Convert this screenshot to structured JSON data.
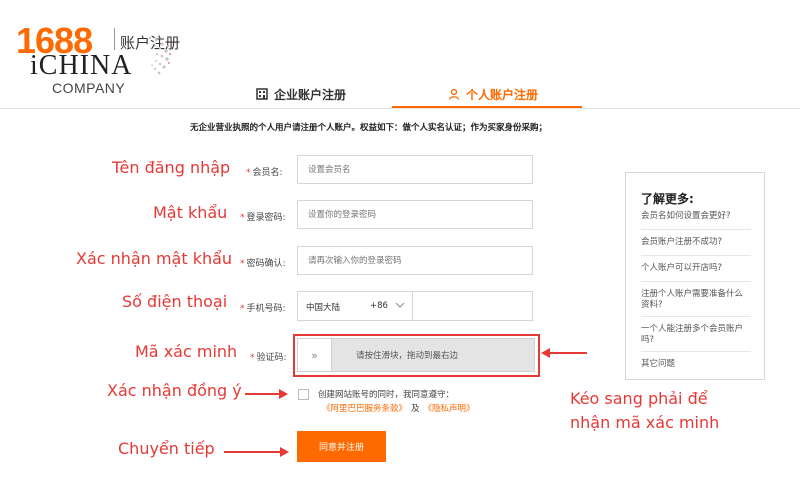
{
  "logo": {
    "brand": "1688",
    "sub": "账户注册",
    "watermark_line1": "iCHINA",
    "watermark_line2": "COMPANY"
  },
  "tabs": [
    {
      "label": "企业账户注册",
      "icon": "building-icon",
      "active": false
    },
    {
      "label": "个人账户注册",
      "icon": "user-icon",
      "active": true
    }
  ],
  "notice": "无企业营业执照的个人用户请注册个人账户。权益如下：做个人实名认证；作为买家身份采购；",
  "form": {
    "username": {
      "label": "会员名:",
      "placeholder": "设置会员名"
    },
    "password": {
      "label": "登录密码:",
      "placeholder": "设置你的登录密码"
    },
    "confirm": {
      "label": "密码确认:",
      "placeholder": "请再次输入你的登录密码"
    },
    "phone": {
      "label": "手机号码:",
      "country": "中国大陆",
      "code": "+86"
    },
    "captcha": {
      "label": "验证码:",
      "handle": "»",
      "text": "请按住滑块，拖动到最右边"
    },
    "agree": {
      "line1": "创建网站账号的同时，我同意遵守：",
      "link1": "《阿里巴巴服务条款》",
      "and": "及",
      "link2": "《隐私声明》"
    },
    "submit_label": "同意并注册"
  },
  "annotations": {
    "username": "Tên đăng nhập",
    "password": "Mật khẩu",
    "confirm": "Xác nhận mật khẩu",
    "phone": "Số điện thoại",
    "captcha": "Mã xác minh",
    "agree": "Xác nhận đồng ý",
    "submit": "Chuyển tiếp",
    "slide_line1": "Kéo sang phải để",
    "slide_line2": "nhận mã xác minh",
    "star": "*"
  },
  "sidebar": {
    "title": "了解更多:",
    "items": [
      "会员名如何设置会更好?",
      "会员账户注册不成功?",
      "个人账户可以开店吗?",
      "注册个人账户需要准备什么资料?",
      "一个人能注册多个会员账户吗?",
      "其它问题"
    ]
  },
  "colors": {
    "accent": "#ff6a00",
    "annotation": "#e53935"
  }
}
